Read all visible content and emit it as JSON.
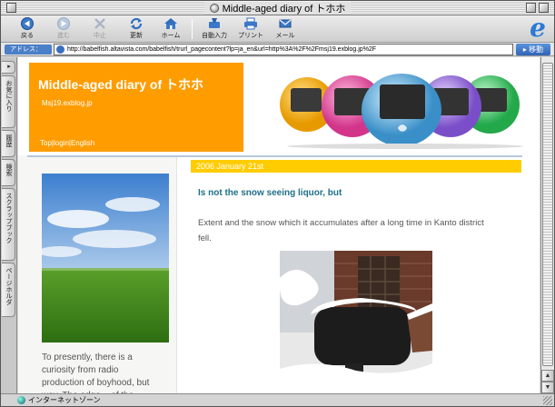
{
  "window": {
    "title": "Middle-aged diary of トホホ"
  },
  "toolbar": {
    "back": "戻る",
    "forward": "進む",
    "stop": "中止",
    "refresh": "更新",
    "home": "ホーム",
    "autofill": "自動入力",
    "print": "プリント",
    "mail": "メール"
  },
  "address": {
    "label": "アドレス：",
    "url": "http://babelfish.altavista.com/babelfish/trurl_pagecontent?lp=ja_en&url=http%3A%2F%2Fmsj19.exblog.jp%2F",
    "go": "移動"
  },
  "sidetabs": [
    "お気に入り",
    "履歴",
    "検索",
    "スクラップブック",
    "ページホルダ"
  ],
  "blog": {
    "title": "Middle-aged diary of トホホ",
    "subtitle": "Msj19.exblog.jp",
    "links": [
      "Top",
      "|",
      "login",
      "|",
      "English"
    ]
  },
  "sidebar": {
    "text": "To presently, there is a curiosity from radio production of boyhood, but way. The edge ○ of the"
  },
  "post": {
    "date": "2006 January 21st",
    "title": "Is not the snow seeing liquor, but",
    "body": "Extent and the snow which it accumulates after a long time in Kanto district fell."
  },
  "status": {
    "text": "インターネットゾーン"
  },
  "colors": {
    "header_orange": "#ff9c00",
    "date_bar": "#ffcc00",
    "post_title": "#1e6f8a",
    "address_label": "#4b7fc8"
  }
}
